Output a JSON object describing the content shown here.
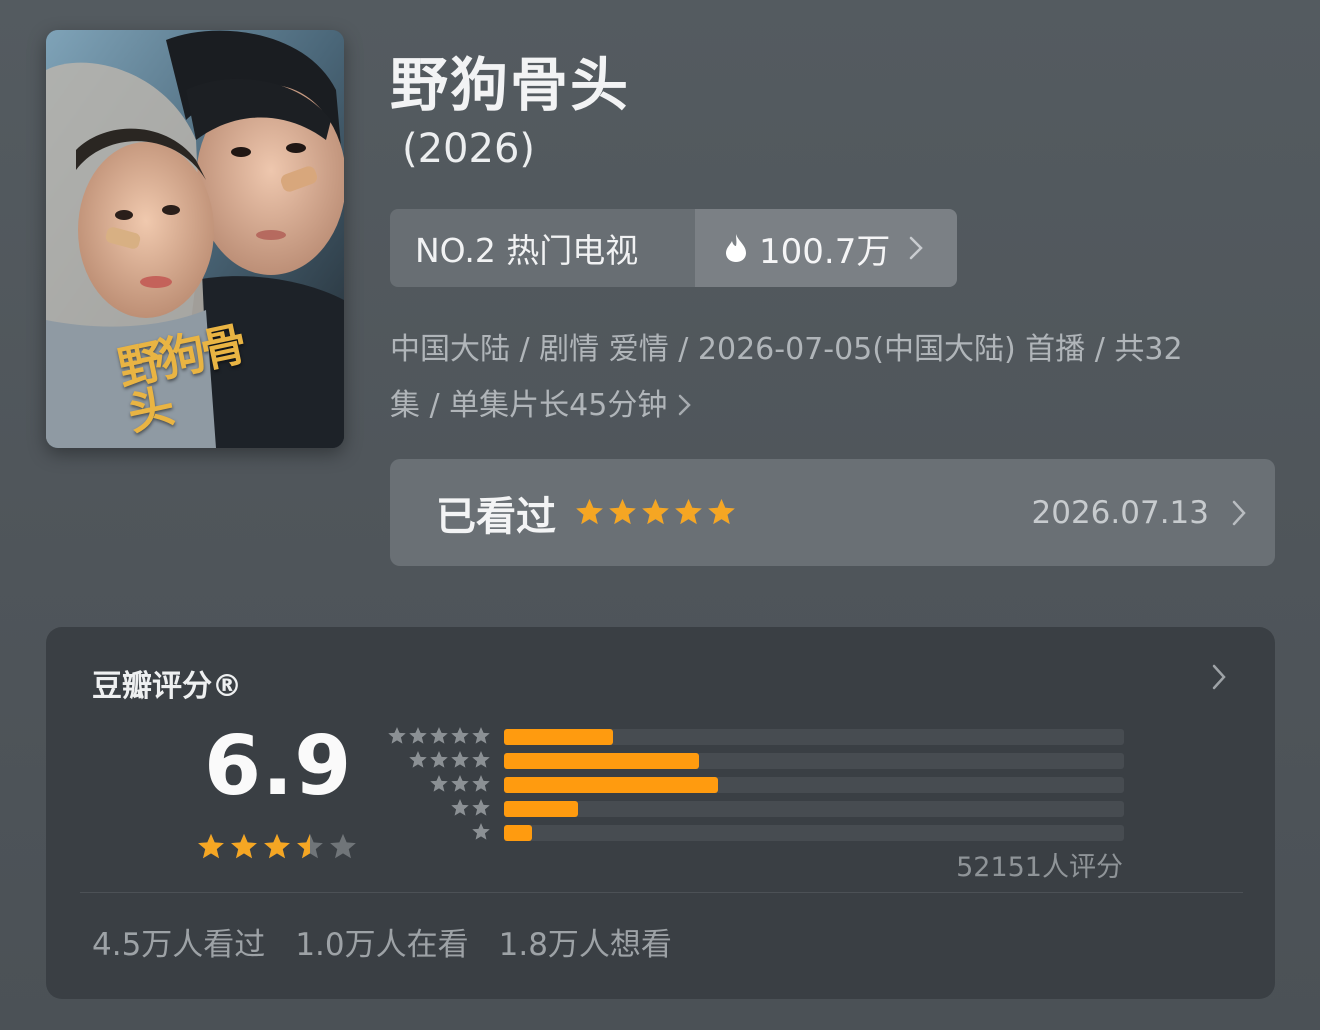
{
  "title": "野狗骨头",
  "year": "(2026)",
  "poster": {
    "logo_text": "野狗骨头"
  },
  "ranking": {
    "label": "NO.2 热门电视",
    "heat": "100.7万",
    "heat_icon": "fire-icon"
  },
  "meta_line1": "中国大陆 / 剧情 爱情 / 2026-07-05(中国大陆) 首播 / 共32",
  "meta_line2": "集 / 单集片长45分钟",
  "watched": {
    "label": "已看过",
    "user_stars": 5,
    "date": "2026.07.13"
  },
  "douban": {
    "title": "豆瓣评分®",
    "score": "6.9",
    "score_stars": 3.5,
    "distribution": [
      {
        "stars": 5,
        "percent": 17.5
      },
      {
        "stars": 4,
        "percent": 31.5
      },
      {
        "stars": 3,
        "percent": 34.5
      },
      {
        "stars": 2,
        "percent": 12.0
      },
      {
        "stars": 1,
        "percent": 4.5
      }
    ],
    "vote_count": "52151人评分",
    "stats": [
      "4.5万人看过",
      "1.0万人在看",
      "1.8万人想看"
    ]
  },
  "colors": {
    "accent_star": "#f5a623",
    "bar_fill": "#ff9b0f",
    "card_bg": "#3a3f44",
    "page_bg": "#4f555a"
  }
}
